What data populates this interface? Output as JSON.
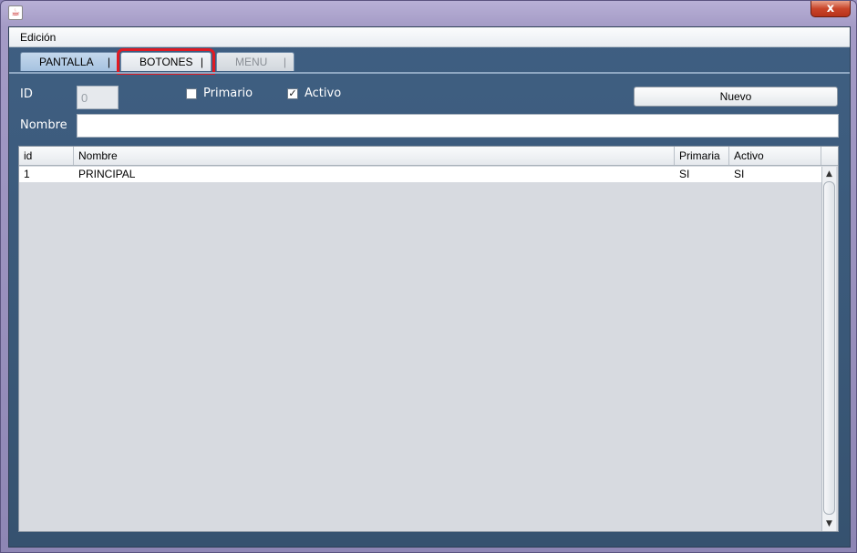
{
  "window": {
    "close_glyph": "x",
    "app_icon": "java-icon"
  },
  "menubar": {
    "items": [
      "Edición"
    ]
  },
  "tabs": [
    {
      "label": "PANTALLA",
      "sep": "|",
      "state": "active"
    },
    {
      "label": "BOTONES",
      "sep": "|",
      "state": "highlighted"
    },
    {
      "label": "MENU",
      "sep": "|",
      "state": "disabled"
    }
  ],
  "form": {
    "id_label": "ID",
    "id_value": "0",
    "primario_label": "Primario",
    "primario_checked": false,
    "activo_label": "Activo",
    "activo_checked": true,
    "activo_check_glyph": "✓",
    "nombre_label": "Nombre",
    "nombre_value": "",
    "nuevo_button": "Nuevo"
  },
  "table": {
    "columns": [
      "id",
      "Nombre",
      "Primaria",
      "Activo"
    ],
    "rows": [
      [
        "1",
        "PRINCIPAL",
        "SI",
        "SI"
      ]
    ]
  },
  "scrollbar": {
    "up_glyph": "▲",
    "down_glyph": "▼"
  },
  "colors": {
    "highlight": "#e01b24",
    "client_bg": "#3f5f82"
  }
}
